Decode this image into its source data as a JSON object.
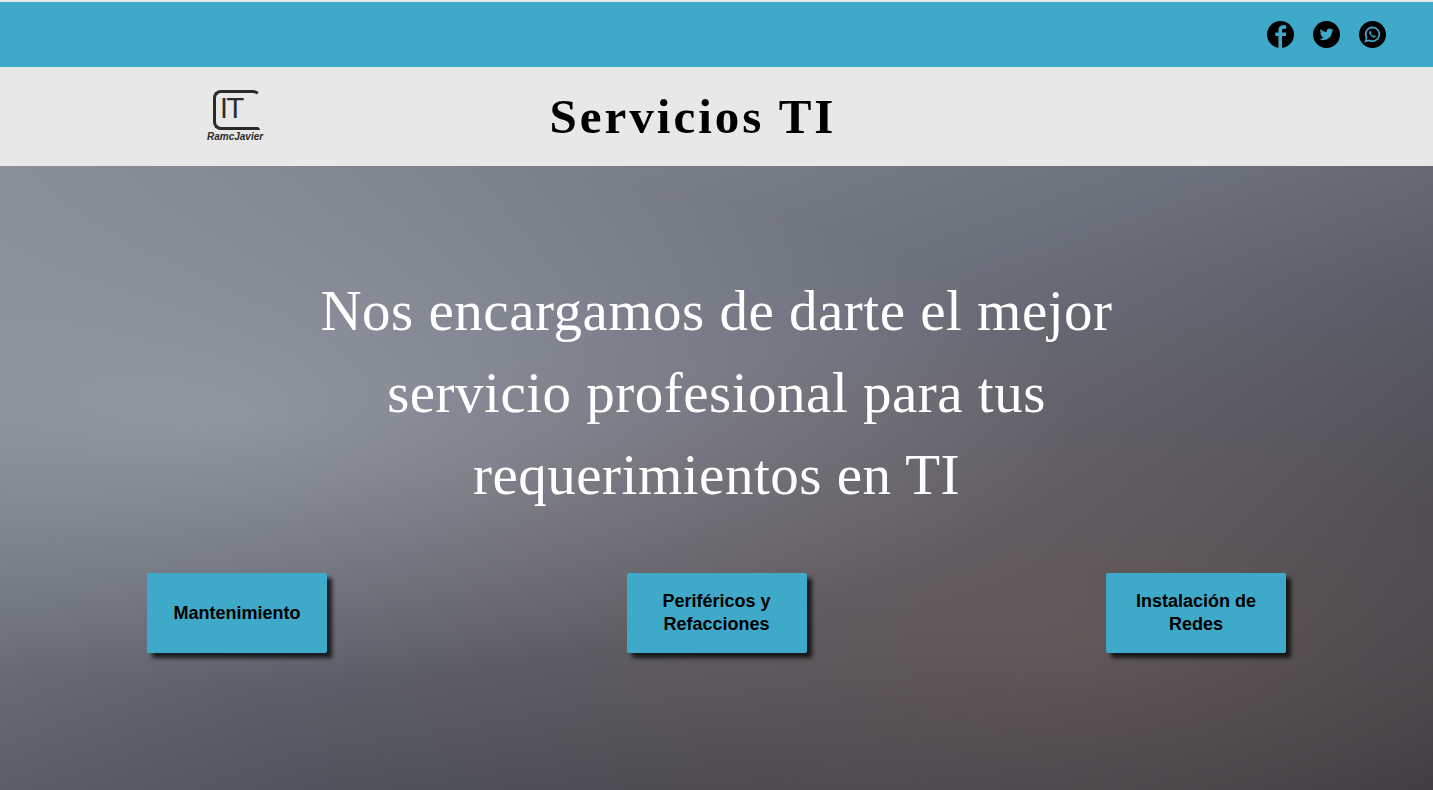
{
  "brand": {
    "mark": "IT",
    "caption": "RamcJavier"
  },
  "header": {
    "title": "Servicios TI"
  },
  "hero": {
    "headline": "Nos encargamos de darte el mejor servicio profesional para tus requerimientos en TI"
  },
  "services": [
    "Mantenimiento",
    "Periféricos y Refacciones",
    "Instalación de Redes"
  ]
}
